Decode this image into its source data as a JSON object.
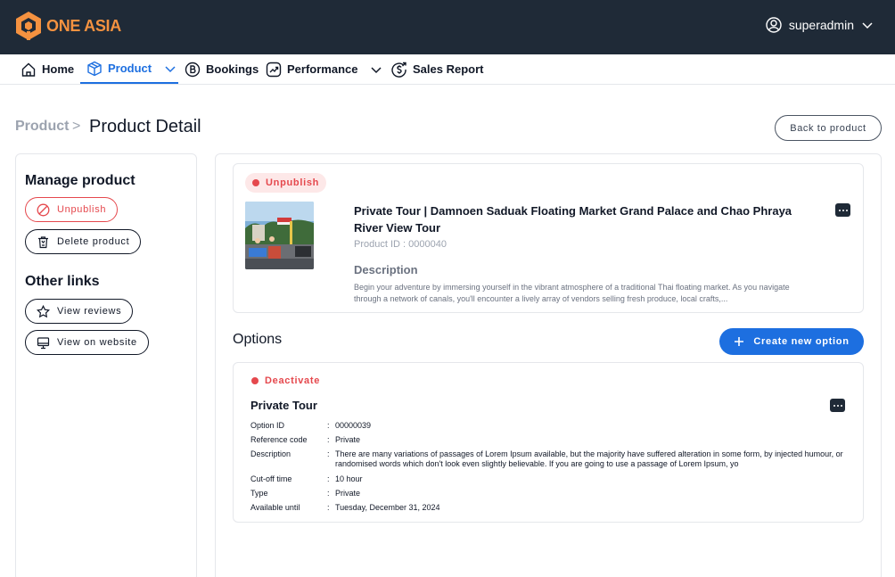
{
  "header": {
    "brand": "ONE ASIA",
    "brand_color": "#f59240",
    "user_icon": "user-circle-icon",
    "username": "superadmin"
  },
  "nav": {
    "items": [
      {
        "label": "Home",
        "icon": "home-icon"
      },
      {
        "label": "Product",
        "icon": "box-icon",
        "active": true
      },
      {
        "label": "Bookings",
        "icon": "bookings-icon"
      },
      {
        "label": "Performance",
        "icon": "trend-icon"
      },
      {
        "label": "Sales Report",
        "icon": "dollar-icon"
      }
    ]
  },
  "breadcrumb": {
    "root": "Product",
    "separator": ">",
    "current": "Product Detail"
  },
  "actions": {
    "back_label": "Back to product"
  },
  "sidebar": {
    "manage_title": "Manage product",
    "unpublish_label": "Unpublish",
    "delete_label": "Delete product",
    "other_title": "Other links",
    "view_reviews_label": "View reviews",
    "view_website_label": "View on website"
  },
  "product": {
    "status": "Unpublish",
    "status_color": "#e5484d",
    "title": "Private Tour | Damnoen Saduak Floating Market Grand Palace and Chao Phraya River View Tour",
    "product_id": "Product ID : 0000040",
    "description_heading": "Description",
    "description": "Begin your adventure by immersing yourself in the vibrant atmosphere of a traditional Thai floating market. As you navigate through a network of canals, you'll encounter a lively array of vendors selling fresh produce, local crafts,..."
  },
  "options": {
    "heading": "Options",
    "create_label": "Create new option",
    "accent_color": "#1d6fe0",
    "items": [
      {
        "status": "Deactivate",
        "title": "Private Tour",
        "fields": [
          {
            "key": "Option ID",
            "value": "00000039"
          },
          {
            "key": "Reference code",
            "value": "Private"
          },
          {
            "key": "Description",
            "value": "There are many variations of passages of Lorem Ipsum available, but the majority have suffered alteration in some form, by injected humour, or randomised words which don't look even slightly believable. If you are going to use a passage of Lorem Ipsum, yo"
          },
          {
            "key": "Cut-off time",
            "value": "10 hour"
          },
          {
            "key": "Type",
            "value": "Private"
          },
          {
            "key": "Available until",
            "value": "Tuesday, December 31, 2024"
          }
        ]
      }
    ]
  }
}
